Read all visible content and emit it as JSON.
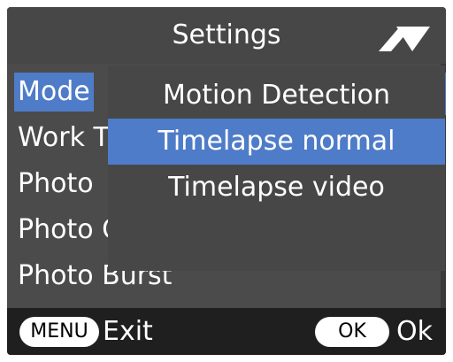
{
  "header": {
    "title": "Settings",
    "nav_icon": "triangle-up-down-icon"
  },
  "menu": {
    "items": [
      {
        "label": "Mode",
        "selected": true
      },
      {
        "label": "Work T"
      },
      {
        "label": "Photo"
      },
      {
        "label": "Photo Quality"
      },
      {
        "label": "Photo Burst"
      }
    ]
  },
  "popup": {
    "options": [
      {
        "label": "Motion Detection"
      },
      {
        "label": "Timelapse normal",
        "selected": true
      },
      {
        "label": "Timelapse video"
      }
    ]
  },
  "footer": {
    "menu_key": "MENU",
    "menu_action": "Exit",
    "ok_key": "OK",
    "ok_action": "Ok"
  },
  "colors": {
    "accent": "#4e7cc8",
    "background": "#474747",
    "footer": "#1f1f1f"
  }
}
